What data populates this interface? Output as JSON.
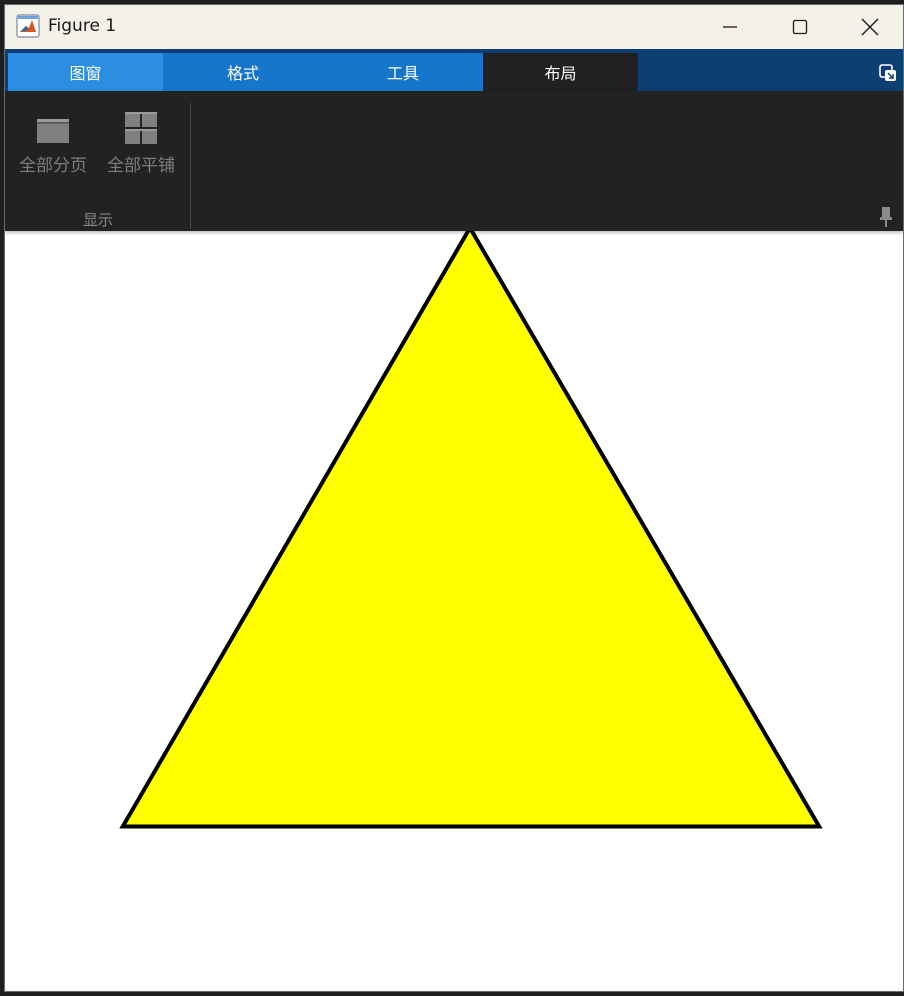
{
  "window": {
    "title": "Figure 1"
  },
  "tabs": [
    {
      "label": "图窗",
      "state": "hover"
    },
    {
      "label": "格式",
      "state": "normal"
    },
    {
      "label": "工具",
      "state": "normal"
    },
    {
      "label": "布局",
      "state": "selected"
    }
  ],
  "ribbon": {
    "buttons": [
      {
        "label": "全部分页",
        "icon": "single-page-icon"
      },
      {
        "label": "全部平铺",
        "icon": "tile-grid-icon"
      }
    ],
    "group_label": "显示"
  },
  "figure": {
    "shape": "triangle",
    "fill_color": "#ffff00",
    "edge_color": "#000000"
  },
  "colors": {
    "titlebar": "#f3f1e8",
    "tabstrip": "#0e3f72",
    "tab_active": "#202020",
    "tab_hover": "#2b8ee0",
    "tab_normal": "#1676cc",
    "ribbon": "#222222"
  }
}
